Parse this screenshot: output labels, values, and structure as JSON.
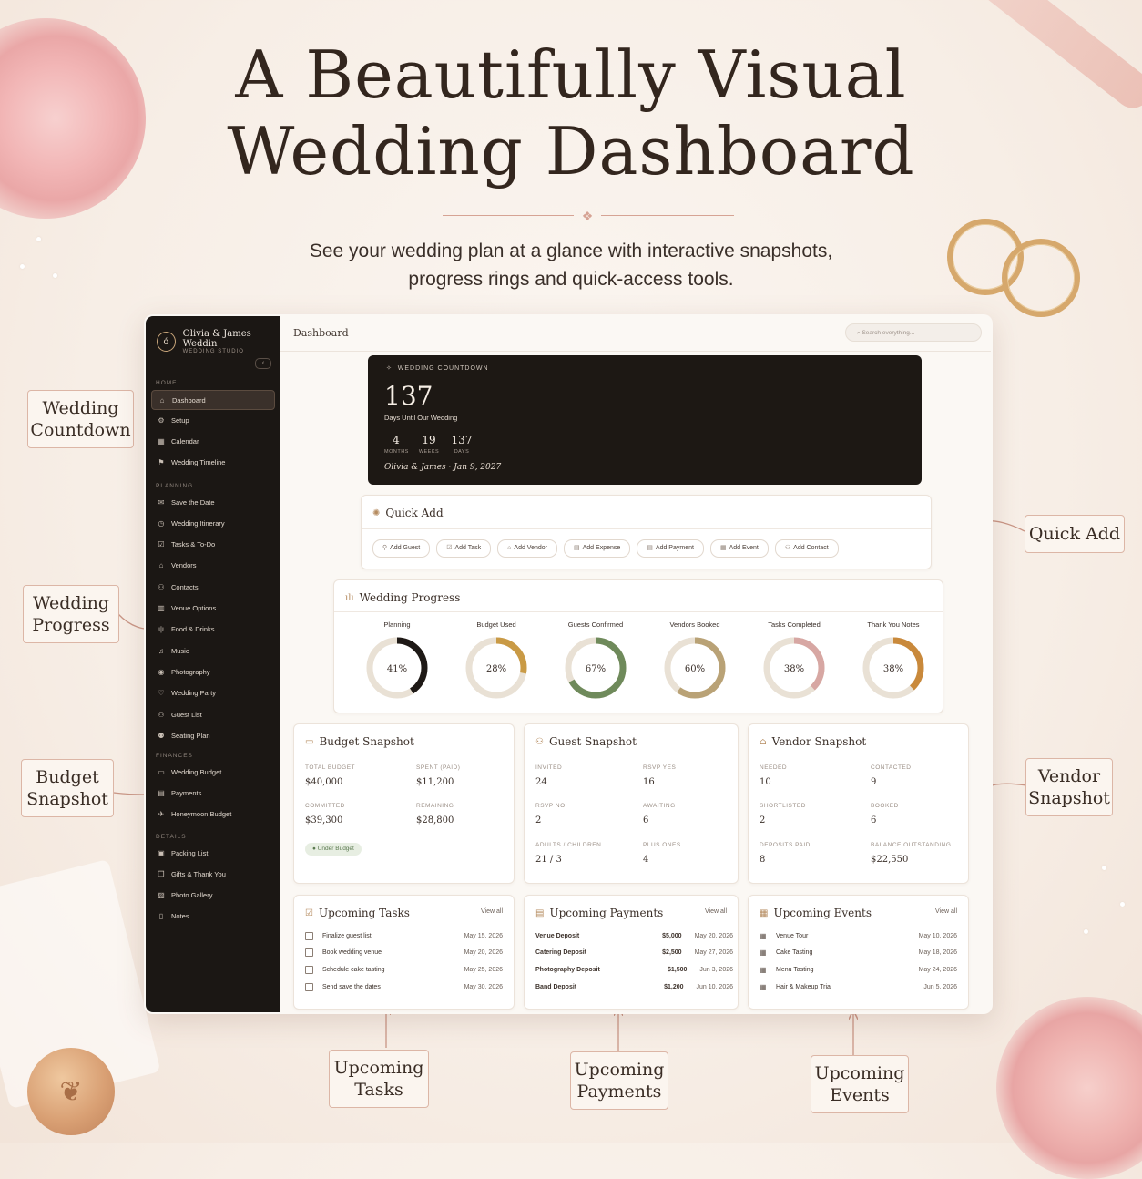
{
  "headline": {
    "line1": "A Beautifully Visual",
    "line2": "Wedding Dashboard"
  },
  "subtitle": {
    "line1": "See your wedding plan at a glance with interactive snapshots,",
    "line2": "progress rings and quick-access tools."
  },
  "callouts": {
    "wedding_countdown": [
      "Wedding",
      "Countdown"
    ],
    "wedding_progress": [
      "Wedding",
      "Progress"
    ],
    "budget_snapshot": [
      "Budget",
      "Snapshot"
    ],
    "quick_add": [
      "Quick Add"
    ],
    "vendor_snapshot": [
      "Vendor",
      "Snapshot"
    ],
    "upcoming_tasks": [
      "Upcoming",
      "Tasks"
    ],
    "upcoming_payments": [
      "Upcoming",
      "Payments"
    ],
    "upcoming_events": [
      "Upcoming",
      "Events"
    ]
  },
  "sidebar": {
    "brand_name": "Olivia & James Weddin",
    "brand_sub": "WEDDING STUDIO",
    "logo_glyph": "ó",
    "sections": {
      "home": "HOME",
      "planning": "PLANNING",
      "finances": "FINANCES",
      "details": "DETAILS"
    },
    "home_items": [
      {
        "label": "Dashboard",
        "icon": "home-icon",
        "active": true
      },
      {
        "label": "Setup",
        "icon": "gear-icon"
      },
      {
        "label": "Calendar",
        "icon": "calendar-icon"
      },
      {
        "label": "Wedding Timeline",
        "icon": "flag-icon"
      }
    ],
    "planning_items": [
      {
        "label": "Save the Date",
        "icon": "mail-icon"
      },
      {
        "label": "Wedding Itinerary",
        "icon": "clock-icon"
      },
      {
        "label": "Tasks & To-Do",
        "icon": "checkbox-icon"
      },
      {
        "label": "Vendors",
        "icon": "store-icon"
      },
      {
        "label": "Contacts",
        "icon": "users-icon"
      },
      {
        "label": "Venue Options",
        "icon": "building-icon"
      },
      {
        "label": "Food & Drinks",
        "icon": "utensils-icon"
      },
      {
        "label": "Music",
        "icon": "music-icon"
      },
      {
        "label": "Photography",
        "icon": "camera-icon"
      },
      {
        "label": "Wedding Party",
        "icon": "heart-icon"
      },
      {
        "label": "Guest List",
        "icon": "guests-icon"
      },
      {
        "label": "Seating Plan",
        "icon": "seating-icon"
      }
    ],
    "finance_items": [
      {
        "label": "Wedding Budget",
        "icon": "wallet-icon"
      },
      {
        "label": "Payments",
        "icon": "card-icon"
      },
      {
        "label": "Honeymoon Budget",
        "icon": "plane-icon"
      }
    ],
    "detail_items": [
      {
        "label": "Packing List",
        "icon": "suitcase-icon"
      },
      {
        "label": "Gifts & Thank You",
        "icon": "gift-icon"
      },
      {
        "label": "Photo Gallery",
        "icon": "image-icon"
      },
      {
        "label": "Notes",
        "icon": "note-icon"
      }
    ]
  },
  "topbar": {
    "breadcrumb": "Dashboard",
    "search_placeholder": "Search everything..."
  },
  "countdown": {
    "label": "WEDDING COUNTDOWN",
    "days": "137",
    "days_text": "Days Until Our Wedding",
    "units": [
      {
        "value": "4",
        "label": "MONTHS"
      },
      {
        "value": "19",
        "label": "WEEKS"
      },
      {
        "value": "137",
        "label": "DAYS"
      }
    ],
    "couple_date": "Olivia & James · Jan 9, 2027"
  },
  "quick_add": {
    "title": "Quick Add",
    "buttons": [
      {
        "label": "Add Guest",
        "icon": "person-plus-icon"
      },
      {
        "label": "Add Task",
        "icon": "check-square-icon"
      },
      {
        "label": "Add Vendor",
        "icon": "store-icon"
      },
      {
        "label": "Add Expense",
        "icon": "receipt-icon"
      },
      {
        "label": "Add Payment",
        "icon": "card-icon"
      },
      {
        "label": "Add Event",
        "icon": "calendar-icon"
      },
      {
        "label": "Add Contact",
        "icon": "contact-icon"
      }
    ]
  },
  "progress": {
    "title": "Wedding Progress",
    "rings": [
      {
        "label": "Planning",
        "percent": 41,
        "text": "41%",
        "color": "#1e1916"
      },
      {
        "label": "Budget Used",
        "percent": 28,
        "text": "28%",
        "color": "#c99a45"
      },
      {
        "label": "Guests Confirmed",
        "percent": 67,
        "text": "67%",
        "color": "#6f8a5b"
      },
      {
        "label": "Vendors Booked",
        "percent": 60,
        "text": "60%",
        "color": "#b9a276"
      },
      {
        "label": "Tasks Completed",
        "percent": 38,
        "text": "38%",
        "color": "#d7a7a3"
      },
      {
        "label": "Thank You Notes",
        "percent": 38,
        "text": "38%",
        "color": "#c9893b"
      }
    ]
  },
  "budget": {
    "title": "Budget Snapshot",
    "fields": [
      {
        "k": "TOTAL BUDGET",
        "v": "$40,000"
      },
      {
        "k": "SPENT (PAID)",
        "v": "$11,200"
      },
      {
        "k": "COMMITTED",
        "v": "$39,300"
      },
      {
        "k": "REMAINING",
        "v": "$28,800"
      }
    ],
    "badge": "● Under Budget"
  },
  "guest": {
    "title": "Guest Snapshot",
    "fields": [
      {
        "k": "INVITED",
        "v": "24"
      },
      {
        "k": "RSVP YES",
        "v": "16"
      },
      {
        "k": "RSVP NO",
        "v": "2"
      },
      {
        "k": "AWAITING",
        "v": "6"
      },
      {
        "k": "ADULTS / CHILDREN",
        "v": "21 / 3"
      },
      {
        "k": "PLUS ONES",
        "v": "4"
      }
    ]
  },
  "vendor": {
    "title": "Vendor Snapshot",
    "fields": [
      {
        "k": "NEEDED",
        "v": "10"
      },
      {
        "k": "CONTACTED",
        "v": "9"
      },
      {
        "k": "SHORTLISTED",
        "v": "2"
      },
      {
        "k": "BOOKED",
        "v": "6"
      },
      {
        "k": "DEPOSITS PAID",
        "v": "8"
      },
      {
        "k": "BALANCE OUTSTANDING",
        "v": "$22,550"
      }
    ]
  },
  "tasks": {
    "title": "Upcoming Tasks",
    "view_all": "View all",
    "rows": [
      {
        "label": "Finalize guest list",
        "date": "May 15, 2026"
      },
      {
        "label": "Book wedding venue",
        "date": "May 20, 2026"
      },
      {
        "label": "Schedule cake tasting",
        "date": "May 25, 2026"
      },
      {
        "label": "Send save the dates",
        "date": "May 30, 2026"
      }
    ]
  },
  "payments": {
    "title": "Upcoming Payments",
    "view_all": "View all",
    "rows": [
      {
        "label": "Venue Deposit",
        "amount": "$5,000",
        "date": "May 20, 2026"
      },
      {
        "label": "Catering Deposit",
        "amount": "$2,500",
        "date": "May 27, 2026"
      },
      {
        "label": "Photography Deposit",
        "amount": "$1,500",
        "date": "Jun 3, 2026"
      },
      {
        "label": "Band Deposit",
        "amount": "$1,200",
        "date": "Jun 10, 2026"
      }
    ]
  },
  "events": {
    "title": "Upcoming Events",
    "view_all": "View all",
    "rows": [
      {
        "label": "Venue Tour",
        "date": "May 10, 2026"
      },
      {
        "label": "Cake Tasting",
        "date": "May 18, 2026"
      },
      {
        "label": "Menu Tasting",
        "date": "May 24, 2026"
      },
      {
        "label": "Hair & Makeup Trial",
        "date": "Jun 5, 2026"
      }
    ]
  }
}
